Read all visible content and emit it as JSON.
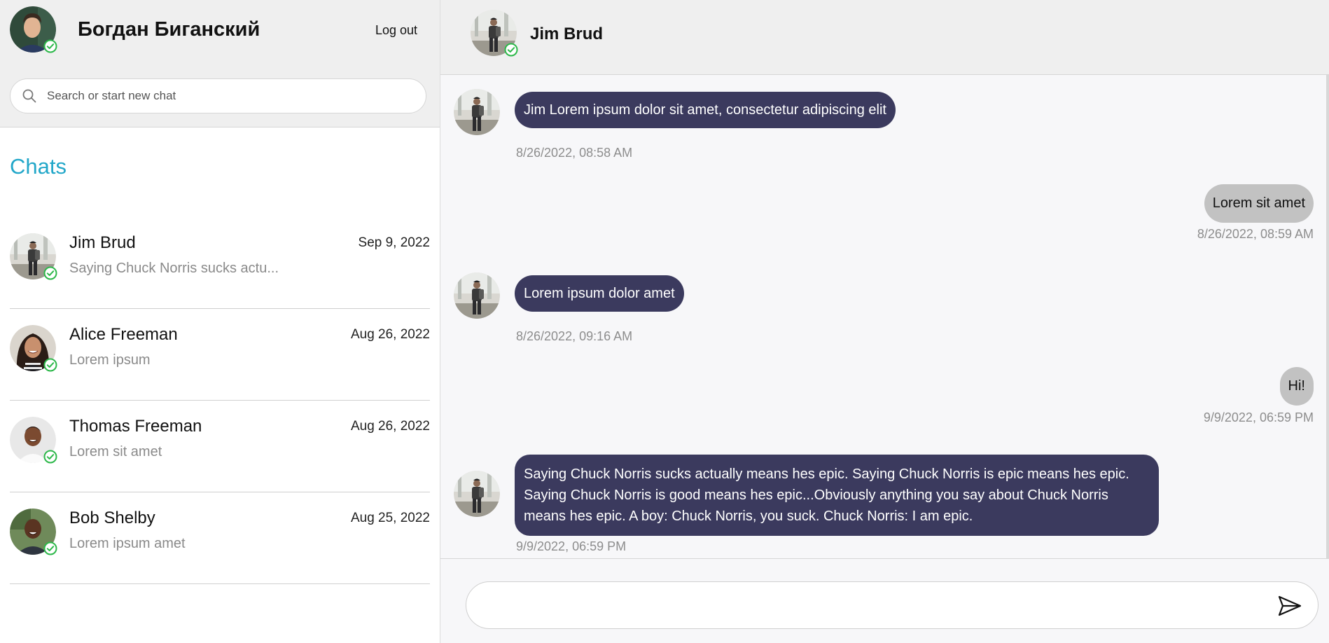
{
  "current_user": {
    "name": "Богдан Биганский",
    "logout_label": "Log out"
  },
  "search": {
    "placeholder": "Search or start new chat"
  },
  "sidebar": {
    "title": "Chats",
    "chats": [
      {
        "name": "Jim Brud",
        "date": "Sep 9, 2022",
        "preview": "Saying Chuck Norris sucks actu...",
        "avatar": "jim-avatar"
      },
      {
        "name": "Alice Freeman",
        "date": "Aug 26, 2022",
        "preview": "Lorem ipsum",
        "avatar": "alice-avatar"
      },
      {
        "name": "Thomas Freeman",
        "date": "Aug 26, 2022",
        "preview": "Lorem sit amet",
        "avatar": "thomas-avatar"
      },
      {
        "name": "Bob Shelby",
        "date": "Aug 25, 2022",
        "preview": "Lorem ipsum amet",
        "avatar": "bob-avatar"
      }
    ]
  },
  "conversation": {
    "contact_name": "Jim Brud",
    "messages": [
      {
        "direction": "incoming",
        "text": "Jim Lorem ipsum dolor sit amet, consectetur adipiscing elit",
        "time": "8/26/2022, 08:58 AM"
      },
      {
        "direction": "outgoing",
        "text": "Lorem sit amet",
        "time": "8/26/2022, 08:59 AM"
      },
      {
        "direction": "incoming",
        "text": "Lorem ipsum dolor amet",
        "time": "8/26/2022, 09:16 AM"
      },
      {
        "direction": "outgoing",
        "text": "Hi!",
        "time": "9/9/2022, 06:59 PM"
      },
      {
        "direction": "incoming",
        "text": "Saying Chuck Norris sucks actually means hes epic. Saying Chuck Norris is epic means hes epic. Saying Chuck Norris is good means hes epic...Obviously anything you say about Chuck Norris means hes epic. A boy: Chuck Norris, you suck. Chuck Norris: I am epic.",
        "time": "9/9/2022, 06:59 PM"
      }
    ]
  },
  "composer": {
    "value": "",
    "send_icon": "send-icon"
  },
  "colors": {
    "accent": "#22a7c9",
    "incoming_bubble": "#3b3a5e",
    "outgoing_bubble": "#c2c2c2",
    "online_status": "#2db84a"
  }
}
